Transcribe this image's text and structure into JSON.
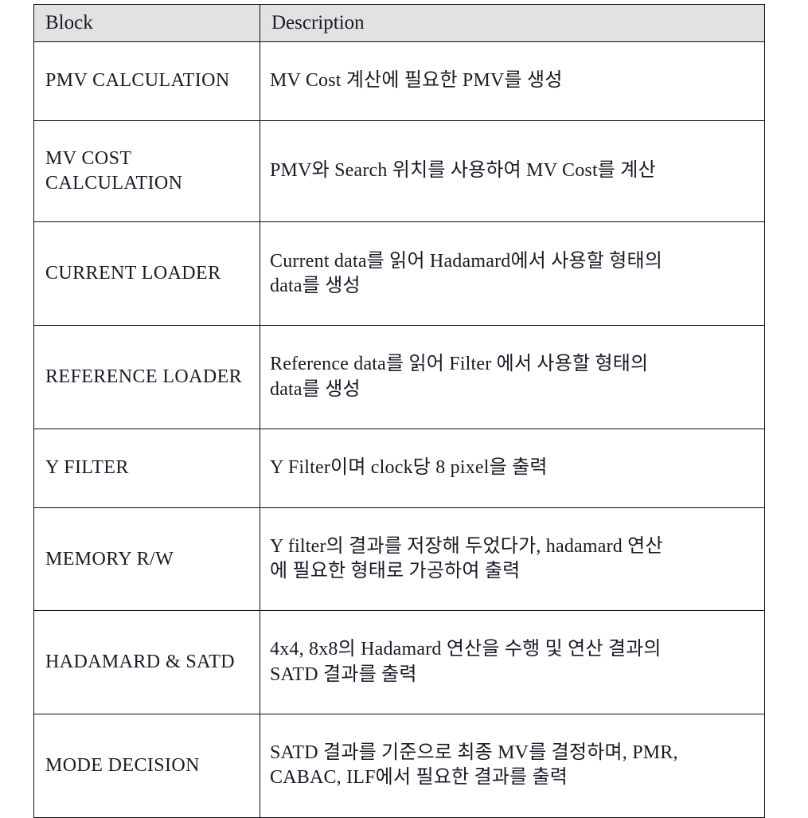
{
  "table": {
    "name": "block-description-table",
    "header_background": "#e2e2e2",
    "border_color": "#0e0e14",
    "columns": [
      {
        "key": "block",
        "label": "Block"
      },
      {
        "key": "description",
        "label": "Description"
      }
    ],
    "rows": [
      {
        "block": "PMV CALCULATION",
        "description": "MV Cost 계산에 필요한 PMV를  생성"
      },
      {
        "block": "MV COST\nCALCULATION",
        "description": "PMV와 Search 위치를 사용하여  MV Cost를 계산"
      },
      {
        "block": "CURRENT LOADER",
        "description": "Current data를 읽어  Hadamard에서 사용할 형태의\ndata를 생성"
      },
      {
        "block": "REFERENCE LOADER",
        "description": "Reference data를 읽어  Filter 에서 사용할 형태의\ndata를 생성"
      },
      {
        "block": "Y FILTER",
        "description": "Y Filter이며 clock당 8  pixel을 출력"
      },
      {
        "block": "MEMORY R/W",
        "description": "Y  filter의 결과를 저장해 두었다가, hadamard 연산\n에 필요한 형태로 가공하여 출력"
      },
      {
        "block": "HADAMARD & SATD",
        "description": "4x4, 8x8의 Hadamard 연산을 수행 및 연산 결과의\nSATD 결과를 출력"
      },
      {
        "block": "MODE DECISION",
        "description": "SATD 결과를 기준으로 최종 MV를 결정하며, PMR,\nCABAC, ILF에서 필요한 결과를 출력"
      }
    ]
  }
}
